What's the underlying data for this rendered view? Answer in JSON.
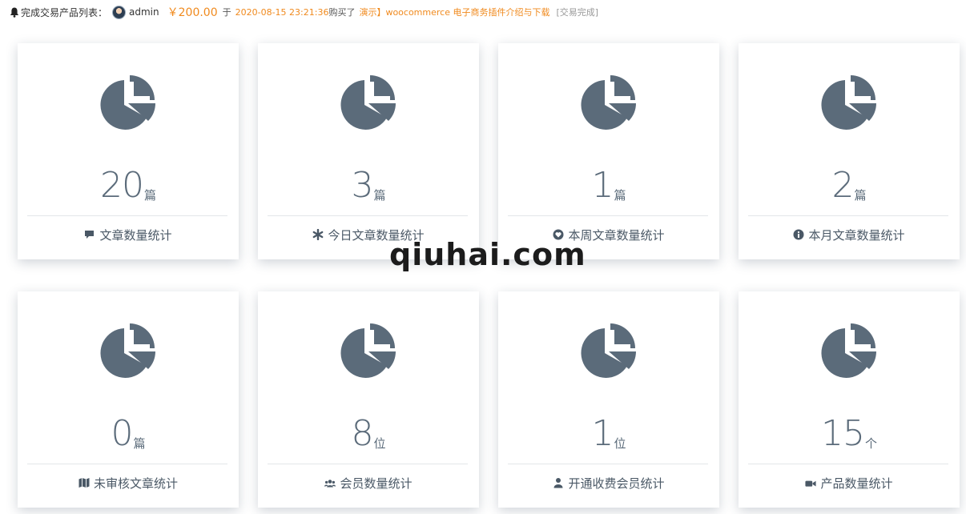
{
  "ticker": {
    "label": "完成交易产品列表：",
    "user": "admin",
    "price": "￥200.00",
    "preposition": "于",
    "datetime": "2020-08-15 23:21:36",
    "action": "购买了",
    "product": "演示】woocommerce 电子商务插件介绍与下载",
    "status": "[交易完成]"
  },
  "cards": [
    {
      "value": "20",
      "unit": "篇",
      "caption": "文章数量统计",
      "icon": "comment-icon"
    },
    {
      "value": "3",
      "unit": "篇",
      "caption": "今日文章数量统计",
      "icon": "asterisk-icon"
    },
    {
      "value": "1",
      "unit": "篇",
      "caption": "本周文章数量统计",
      "icon": "heart-icon"
    },
    {
      "value": "2",
      "unit": "篇",
      "caption": "本月文章数量统计",
      "icon": "info-icon"
    },
    {
      "value": "0",
      "unit": "篇",
      "caption": "未审核文章统计",
      "icon": "map-icon"
    },
    {
      "value": "8",
      "unit": "位",
      "caption": "会员数量统计",
      "icon": "users-icon"
    },
    {
      "value": "1",
      "unit": "位",
      "caption": "开通收费会员统计",
      "icon": "user-icon"
    },
    {
      "value": "15",
      "unit": "个",
      "caption": "产品数量统计",
      "icon": "video-icon"
    }
  ],
  "watermark": "qiuhai.com",
  "colors": {
    "icon": "#5b6b7a",
    "accent": "#f08a1e",
    "text": "#4a5866"
  }
}
